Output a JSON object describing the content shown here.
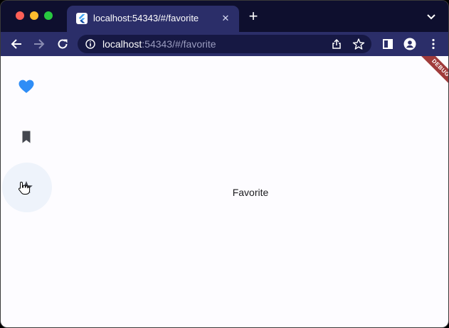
{
  "browser": {
    "tab": {
      "title": "localhost:54343/#/favorite"
    },
    "toolbar": {
      "url_host": "localhost",
      "url_rest": ":54343/#/favorite"
    }
  },
  "nav_rail": {
    "destinations": [
      {
        "icon": "heart-icon",
        "selected": true,
        "color": "#2f8df6"
      },
      {
        "icon": "bookmark-icon",
        "selected": false,
        "color": "#44474f"
      },
      {
        "icon": "star-icon",
        "selected": false,
        "color": "#44474f",
        "hovered": true
      }
    ]
  },
  "content": {
    "label": "Favorite"
  },
  "debug_banner": {
    "text": "DEBUG"
  }
}
